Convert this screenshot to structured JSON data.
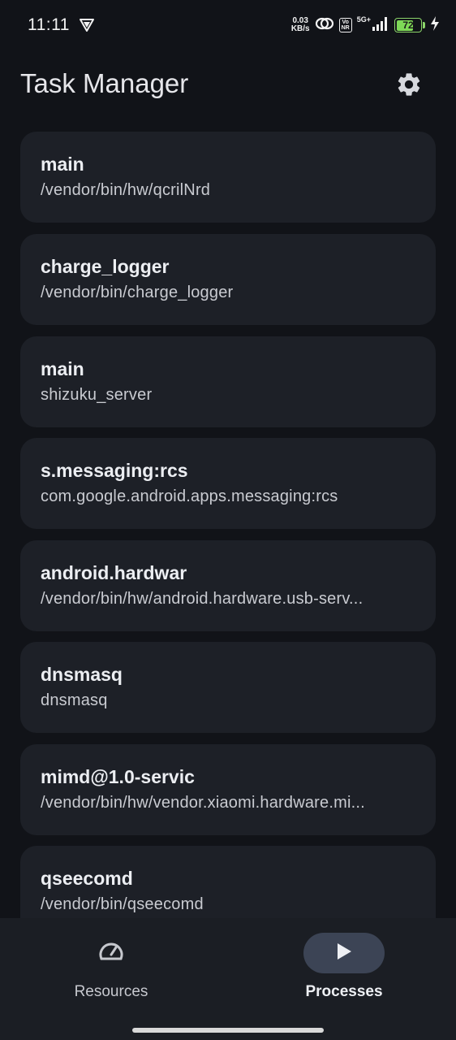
{
  "status_bar": {
    "time": "11:11",
    "net_speed_value": "0.03",
    "net_speed_unit": "KB/s",
    "volte_top": "Vo",
    "volte_bottom": "NR",
    "network_type": "5G+",
    "battery_level": "72",
    "battery_fraction": 0.72
  },
  "header": {
    "title": "Task Manager",
    "settings_icon": "gear-icon"
  },
  "processes": [
    {
      "name": "main",
      "path": "/vendor/bin/hw/qcrilNrd"
    },
    {
      "name": "charge_logger",
      "path": "/vendor/bin/charge_logger"
    },
    {
      "name": "main",
      "path": "shizuku_server"
    },
    {
      "name": "s.messaging:rcs",
      "path": "com.google.android.apps.messaging:rcs"
    },
    {
      "name": "android.hardwar",
      "path": "/vendor/bin/hw/android.hardware.usb-serv..."
    },
    {
      "name": "dnsmasq",
      "path": "dnsmasq"
    },
    {
      "name": "mimd@1.0-servic",
      "path": "/vendor/bin/hw/vendor.xiaomi.hardware.mi..."
    },
    {
      "name": "qseecomd",
      "path": "/vendor/bin/qseecomd"
    }
  ],
  "bottom_nav": {
    "resources_label": "Resources",
    "resources_icon": "speedometer-icon",
    "processes_label": "Processes",
    "processes_icon": "play-icon",
    "active": "processes"
  },
  "colors": {
    "background": "#111318",
    "card": "#1d2027",
    "nav_background": "#1b1e24",
    "nav_active_pill": "#3c4455",
    "battery": "#7ed957"
  }
}
